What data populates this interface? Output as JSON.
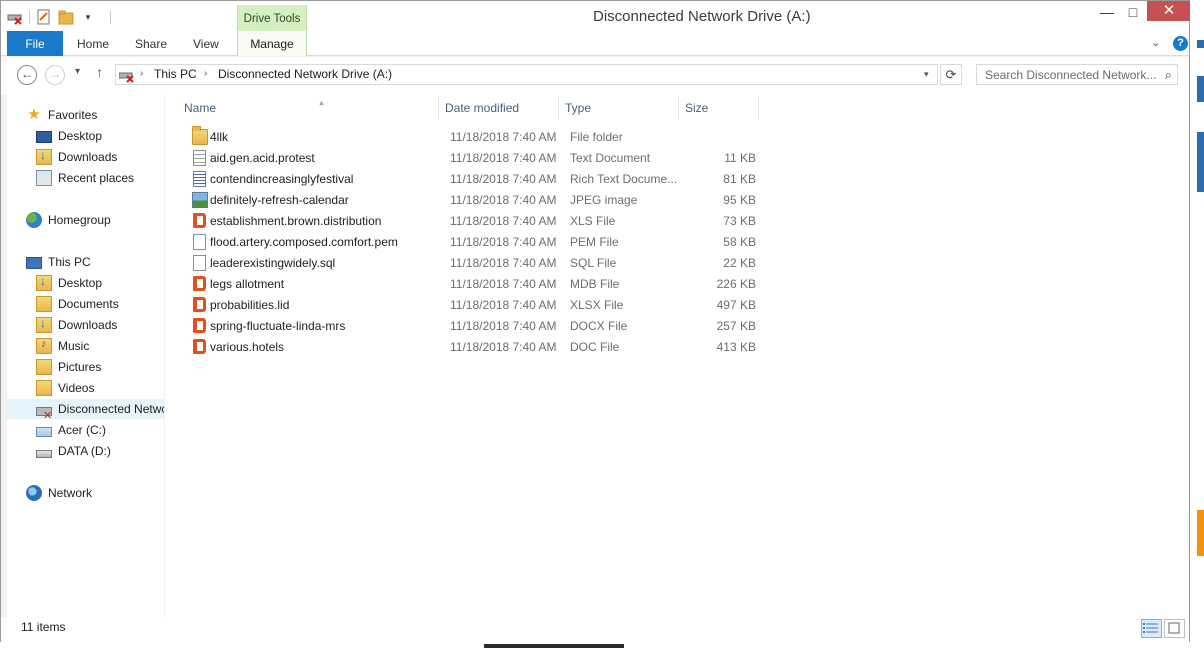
{
  "window": {
    "title": "Disconnected Network Drive (A:)",
    "minimize_label": "—",
    "maximize_label": "□",
    "close_label": "✕"
  },
  "ribbon": {
    "context_group": "Drive Tools",
    "tabs": [
      "File",
      "Home",
      "Share",
      "View",
      "Manage"
    ],
    "expand_label": "⌄",
    "help_label": "?"
  },
  "address": {
    "segments": [
      "This PC",
      "Disconnected Network Drive (A:)"
    ],
    "search_placeholder": "Search Disconnected Network..."
  },
  "columns": [
    "Name",
    "Date modified",
    "Type",
    "Size"
  ],
  "nav": {
    "favorites": {
      "label": "Favorites",
      "items": [
        "Desktop",
        "Downloads",
        "Recent places"
      ]
    },
    "homegroup": "Homegroup",
    "this_pc": {
      "label": "This PC",
      "items": [
        "Desktop",
        "Documents",
        "Downloads",
        "Music",
        "Pictures",
        "Videos",
        "Disconnected Netwo",
        "Acer (C:)",
        "DATA (D:)"
      ]
    },
    "network": "Network"
  },
  "files": [
    {
      "name": "4llk",
      "date": "11/18/2018 7:40 AM",
      "type": "File folder",
      "size": "",
      "icon": "folder-icon"
    },
    {
      "name": "aid.gen.acid.protest",
      "date": "11/18/2018 7:40 AM",
      "type": "Text Document",
      "size": "11 KB",
      "icon": "text-document-icon"
    },
    {
      "name": "contendincreasinglyfestival",
      "date": "11/18/2018 7:40 AM",
      "type": "Rich Text Docume...",
      "size": "81 KB",
      "icon": "rich-text-document-icon"
    },
    {
      "name": "definitely-refresh-calendar",
      "date": "11/18/2018 7:40 AM",
      "type": "JPEG image",
      "size": "95 KB",
      "icon": "image-icon"
    },
    {
      "name": "establishment.brown.distribution",
      "date": "11/18/2018 7:40 AM",
      "type": "XLS File",
      "size": "73 KB",
      "icon": "office-icon"
    },
    {
      "name": "flood.artery.composed.comfort.pem",
      "date": "11/18/2018 7:40 AM",
      "type": "PEM File",
      "size": "58 KB",
      "icon": "blank-file-icon"
    },
    {
      "name": "leaderexistingwidely.sql",
      "date": "11/18/2018 7:40 AM",
      "type": "SQL File",
      "size": "22 KB",
      "icon": "blank-file-icon"
    },
    {
      "name": "legs allotment",
      "date": "11/18/2018 7:40 AM",
      "type": "MDB File",
      "size": "226 KB",
      "icon": "office-icon"
    },
    {
      "name": "probabilities.lid",
      "date": "11/18/2018 7:40 AM",
      "type": "XLSX File",
      "size": "497 KB",
      "icon": "office-icon"
    },
    {
      "name": "spring-fluctuate-linda-mrs",
      "date": "11/18/2018 7:40 AM",
      "type": "DOCX File",
      "size": "257 KB",
      "icon": "office-icon"
    },
    {
      "name": "various.hotels",
      "date": "11/18/2018 7:40 AM",
      "type": "DOC File",
      "size": "413 KB",
      "icon": "office-icon"
    }
  ],
  "status": {
    "item_count": "11 items"
  },
  "colors": {
    "file_tab": "#1979ca",
    "context_tab": "#d6efc1",
    "close_button": "#c75050",
    "selection": "#e5f3fb"
  }
}
